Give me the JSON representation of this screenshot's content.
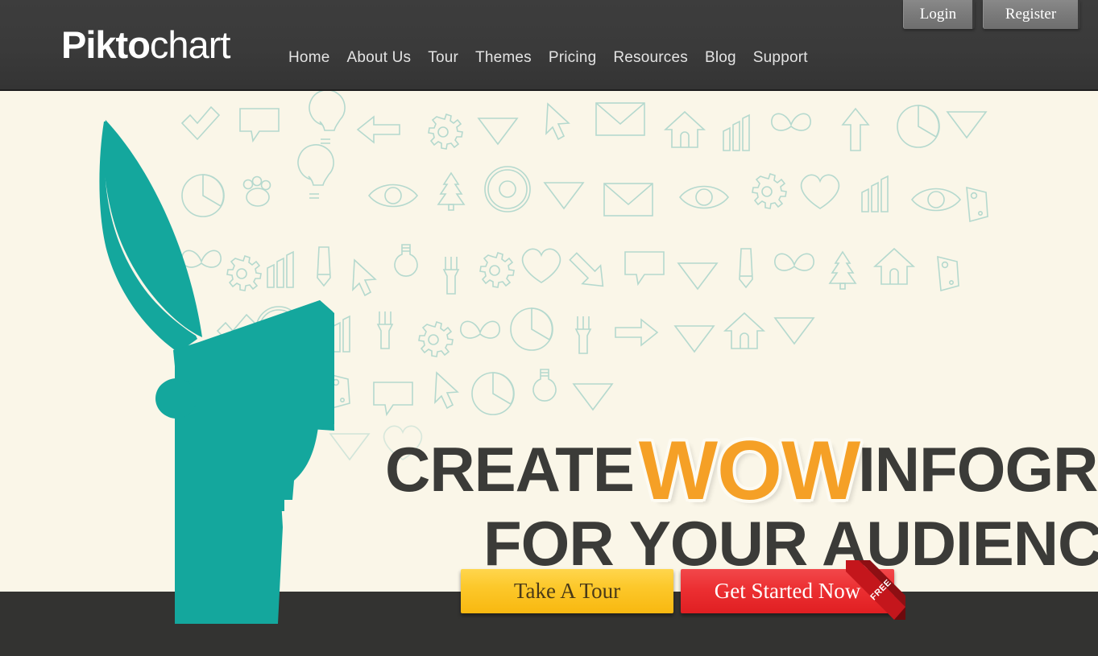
{
  "site": {
    "logo_bold": "Pikto",
    "logo_light": "chart"
  },
  "header": {
    "nav": [
      {
        "label": "Home",
        "name": "nav-item-home"
      },
      {
        "label": "About Us",
        "name": "nav-item-about-us"
      },
      {
        "label": "Tour",
        "name": "nav-item-tour"
      },
      {
        "label": "Themes",
        "name": "nav-item-themes"
      },
      {
        "label": "Pricing",
        "name": "nav-item-pricing"
      },
      {
        "label": "Resources",
        "name": "nav-item-resources"
      },
      {
        "label": "Blog",
        "name": "nav-item-blog"
      },
      {
        "label": "Support",
        "name": "nav-item-support"
      }
    ],
    "login_label": "Login",
    "register_label": "Register"
  },
  "hero": {
    "headline_line1_pre": "CREATE",
    "headline_highlight": "WOW",
    "headline_line1_post": "INFOGRAPHIC",
    "headline_line2": "FOR YOUR AUDIENCE",
    "cta_primary": "Take A Tour",
    "cta_secondary": "Get Started Now",
    "ribbon_label": "FREE"
  },
  "colors": {
    "header_bg": "#3a3a3a",
    "hero_bg": "#faf6e8",
    "bottom_bg": "#333331",
    "teal": "#14a79d",
    "orange": "#f5a026",
    "headline_dark": "#3b3b38",
    "yellow_button": "#fcc82b",
    "red_button": "#ec2f32",
    "pattern_stroke": "#9ecfc6"
  },
  "icons": {
    "head_silhouette": "open-head-icon",
    "pattern_shapes": [
      "pie-chart-icon",
      "gear-icon",
      "lightbulb-icon",
      "envelope-icon",
      "heart-icon",
      "eye-icon",
      "arrow-icon",
      "pencil-icon",
      "fork-icon",
      "tree-icon",
      "butterfly-icon",
      "record-disc-icon",
      "tag-icon",
      "paw-print-icon",
      "bar-chart-icon",
      "house-icon",
      "speech-bubble-icon",
      "check-mark-icon",
      "triangle-icon",
      "cursor-icon"
    ]
  }
}
